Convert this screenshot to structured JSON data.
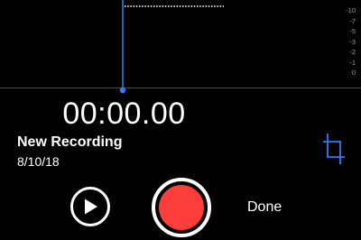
{
  "recording": {
    "timer": "00:00.00",
    "title": "New Recording",
    "date": "8/10/18"
  },
  "db_scale": [
    "-10",
    "-7",
    "-5",
    "-3",
    "-2",
    "-1",
    "0"
  ],
  "controls": {
    "done_label": "Done"
  },
  "icons": {
    "play": "play-icon",
    "record": "record-icon",
    "trim": "trim-icon"
  },
  "colors": {
    "background": "#000000",
    "playhead": "#3a7bf5",
    "record": "#fc3d39",
    "accent": "#2f7cf6"
  }
}
